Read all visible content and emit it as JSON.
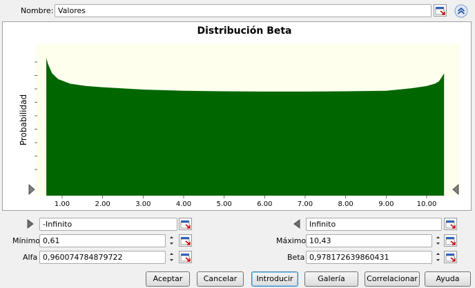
{
  "header": {
    "name_label": "Nombre:",
    "name_value": "Valores",
    "collapse_icon": "double-chevron-up-icon",
    "cellref_icon": "cell-reference-icon"
  },
  "chart_data": {
    "type": "area",
    "title": "Distribución Beta",
    "xlabel": "",
    "ylabel": "Probabilidad",
    "xlim": [
      0.61,
      10.43
    ],
    "ticks": [
      "1.00",
      "2.00",
      "3.00",
      "4.00",
      "5.00",
      "6.00",
      "7.00",
      "8.00",
      "9.00",
      "10.00"
    ],
    "tick_values": [
      1,
      2,
      3,
      4,
      5,
      6,
      7,
      8,
      9,
      10
    ],
    "series": [
      {
        "color": "#006600",
        "x": [
          0.61,
          0.65,
          0.75,
          0.9,
          1.2,
          1.6,
          2.0,
          3.0,
          4.0,
          5.0,
          6.0,
          7.0,
          8.0,
          9.0,
          9.6,
          10.0,
          10.2,
          10.3,
          10.38,
          10.43
        ],
        "y": [
          1.18,
          1.13,
          1.05,
          1.0,
          0.96,
          0.94,
          0.93,
          0.91,
          0.9,
          0.895,
          0.893,
          0.893,
          0.895,
          0.9,
          0.92,
          0.94,
          0.96,
          0.98,
          1.02,
          1.05
        ]
      }
    ],
    "ylim": [
      0,
      1.3
    ],
    "grid": false,
    "legend": "none",
    "plot_background": "#ffffee",
    "panel_background": "#ffffff"
  },
  "params": {
    "left_bound_value": "-Infinito",
    "right_bound_value": "Infinito",
    "min_label": "Mínimo",
    "min_value": "0,61",
    "max_label": "Máximo",
    "max_value": "10,43",
    "alpha_label": "Alfa",
    "alpha_value": "0,960074784879722",
    "beta_label": "Beta",
    "beta_value": "0,978172639860431"
  },
  "buttons": {
    "accept": "Aceptar",
    "cancel": "Cancelar",
    "enter": "Introducir",
    "gallery": "Galería",
    "correlate": "Correlacionar",
    "help": "Ayuda"
  }
}
